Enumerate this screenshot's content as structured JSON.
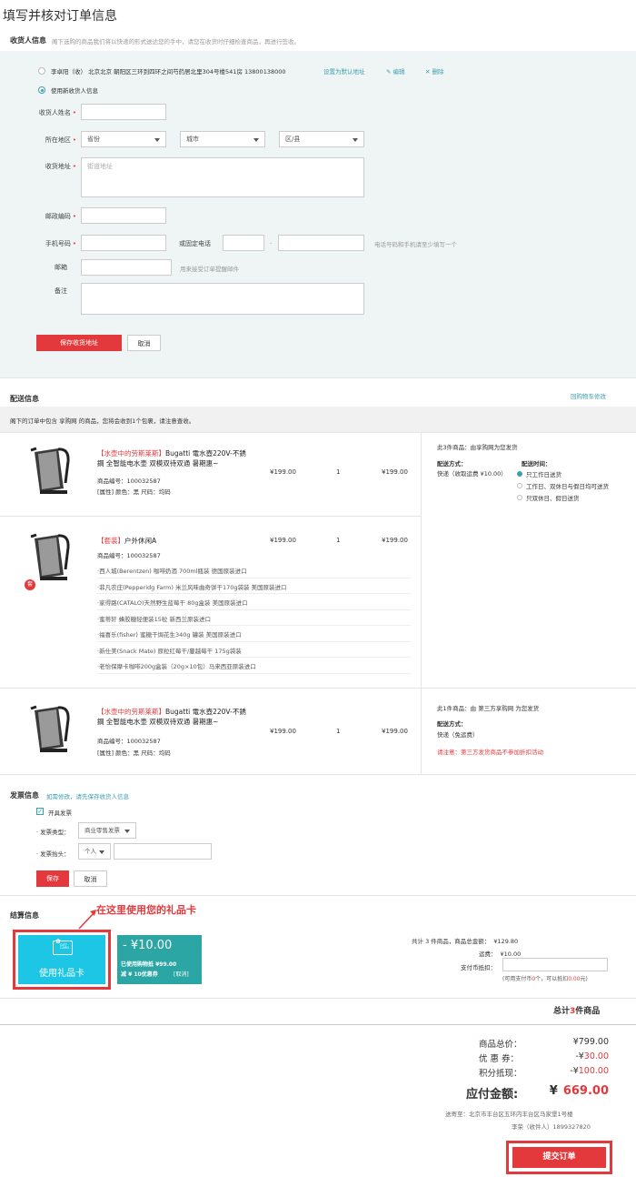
{
  "page": {
    "title": "填写并核对订单信息"
  },
  "address": {
    "section_title": "收货人信息",
    "section_hint": "阁下选购的商品我们将以快递的形式送达您的手中，请您在收货时仔细检查商品，再进行签收。",
    "saved": {
      "text": "李卓阳（收） 北京北京  朝阳区三环到四环之间芍药居北里304号楼541房  13800138000",
      "set_default": "设置为默认地址",
      "edit": "编辑",
      "delete": "删除"
    },
    "new_label": "使用新收货人信息",
    "form": {
      "name_label": "收货人姓名",
      "region_label": "所在地区",
      "province": "省份",
      "city": "城市",
      "district": "区/县",
      "street_label": "收货地址",
      "street_placeholder": "街道地址",
      "zip_label": "邮政编码",
      "mobile_label": "手机号码",
      "phone_label": "或固定电话",
      "phone_sep": "-",
      "phone_hint": "电话号码和手机请至少填写一个",
      "email_label": "邮箱",
      "email_hint": "用来接受订单提醒邮件",
      "remark_label": "备注",
      "save_btn": "保存收货地址",
      "cancel_btn": "取消"
    }
  },
  "delivery": {
    "title": "配送信息",
    "back_link": "回购物车修改",
    "notice": "阁下的订单中包含 享购网 的商品，您将会收到1个包裹，请注意查收。",
    "items": [
      {
        "tag": "【水壶中的劳斯莱斯】",
        "name": "Bugatti 電水壺220V-不銹鋼 全智能电水壶 双模双待双通 暑期惠~",
        "code": "商品编号：100032587",
        "attr": "[属性]  颜色：黑    尺码：均码",
        "price": "¥199.00",
        "qty": "1",
        "total": "¥199.00"
      },
      {
        "tag": "【套装】",
        "name": "户外休闲A",
        "code": "商品编号：100032587",
        "price": "¥199.00",
        "qty": "1",
        "total": "¥199.00",
        "badge": "套",
        "subitems": [
          "·西人城(Berentzen) 咖啡奶酒 700ml瓶装 德国原装进口",
          "·菲凡农庄(Pepperidg Farm) 米兰风味曲奇饼干170g袋装 美国原装进口",
          "·家得路(CATALO)天然野生蓝莓干 80g盒装 美国原装进口",
          "·蜜蒂轩 蜂胶糖轻便装15粒 新西兰原装进口",
          "·福喜乐(fisher) 蜜糖干焗花生340g 罐装 美国原装进口",
          "·新仕美(Snack Mate) 原粒红莓干/蔓越莓干 175g袋装",
          "·老怡保摩卡咖啡200g盒装（20g×10包）马来西亚原装进口"
        ]
      },
      {
        "tag": "【水壶中的劳斯莱斯】",
        "name": "Bugatti 電水壺220V-不銹鋼 全智能电水壶 双模双待双通 暑期惠~",
        "code": "商品编号：100032587",
        "attr": "[属性]  颜色：黑    尺码：均码",
        "price": "¥199.00",
        "qty": "1",
        "total": "¥199.00"
      }
    ],
    "group1": {
      "head": "此3件商品：由享购网为您发货",
      "method_label": "配送方式：",
      "method": "快递（收取运费 ¥10.00）",
      "time_label": "配送时间：",
      "times": [
        "只工作日送货",
        "工作日、双休日与假日均可送货",
        "只双休日、假日送货"
      ]
    },
    "group2": {
      "head": "此1件商品：由 第三方享购网 为您发货",
      "method_label": "配送方式：",
      "method": "快递（免运费）",
      "warn": "请注意：第三方发货商品不参加折扣活动"
    }
  },
  "invoice": {
    "title": "发票信息",
    "hint": "如需修改，请先保存收货人信息",
    "open_label": "开具发票",
    "type_label": "· 发票类型：",
    "type_value": "商业零售发票",
    "head_label": "· 发票抬头：",
    "head_value": "个人",
    "save_btn": "保存",
    "cancel_btn": "取消"
  },
  "settlement": {
    "title": "结算信息",
    "annotation": "在这里使用您的礼品卡",
    "gift_card_btn": "使用礼品卡",
    "gift_card_small": "GIFT CARD",
    "voucher": {
      "amount": "- ¥10.00",
      "used": "已使用购物抵 ¥99.00",
      "discount": "减 ¥ 10优惠券",
      "cancel": "[取消]"
    },
    "summary_line": "共计 3 件商品，商品总金额：",
    "summary_amount": "¥129.80",
    "freight_label": "运费：",
    "freight": "¥10.00",
    "points_label": "支付币抵扣：",
    "points_note_prefix": "(可用支付币",
    "points_available": "0",
    "points_note_mid": "个，可以抵扣",
    "points_deduct": "0.00",
    "points_note_suffix": "元)"
  },
  "total": {
    "count_prefix": "总计",
    "count": "3",
    "count_suffix": "件商品",
    "rows": [
      {
        "label": "商品总价：",
        "value": "¥799.00"
      },
      {
        "label": "优 惠 券：",
        "sign": "-¥",
        "value": "30.00"
      },
      {
        "label": "积分抵现：",
        "sign": "-¥",
        "value": "100.00"
      }
    ],
    "pay_label": "应付金额:",
    "pay_currency": "¥",
    "pay_value": "669.00",
    "address": "送寄至：北京市丰台区五环内丰台区马家堡1号楼",
    "receiver": "李荣（收件人）1899327820",
    "submit_btn": "提交订单"
  },
  "colors": {
    "accent": "#e4393c",
    "teal": "#3a9fb0",
    "gift": "#1ec6e6"
  }
}
